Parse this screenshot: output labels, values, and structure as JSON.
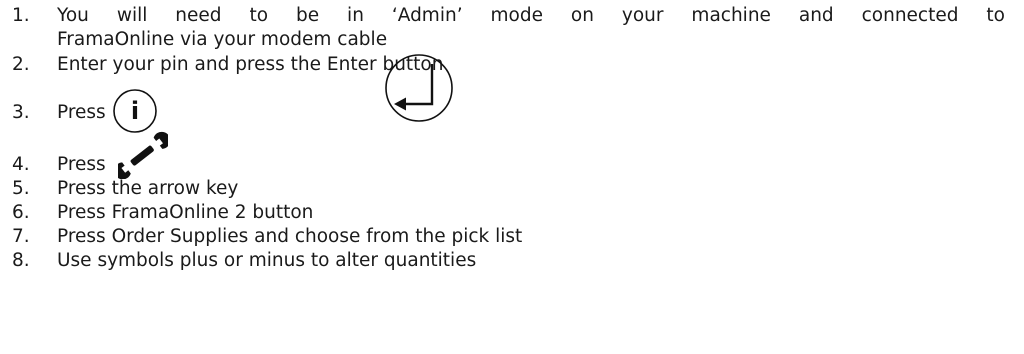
{
  "steps": [
    {
      "num": "1.",
      "text": "You will need to be in ‘Admin’ mode on your machine and connected to",
      "text2": "FramaOnline via your modem cable"
    },
    {
      "num": "2.",
      "text": "Enter your pin and press the Enter button"
    },
    {
      "num": "3.",
      "text": "Press"
    },
    {
      "num": "4.",
      "text": "Press"
    },
    {
      "num": "5.",
      "text": "Press the arrow key"
    },
    {
      "num": "6.",
      "text": "Press FramaOnline 2 button"
    },
    {
      "num": "7.",
      "text": "Press Order Supplies and choose from the pick list"
    },
    {
      "num": "8.",
      "text": "Use symbols plus or minus to alter quantities"
    }
  ],
  "icons": {
    "info_glyph": "i"
  }
}
